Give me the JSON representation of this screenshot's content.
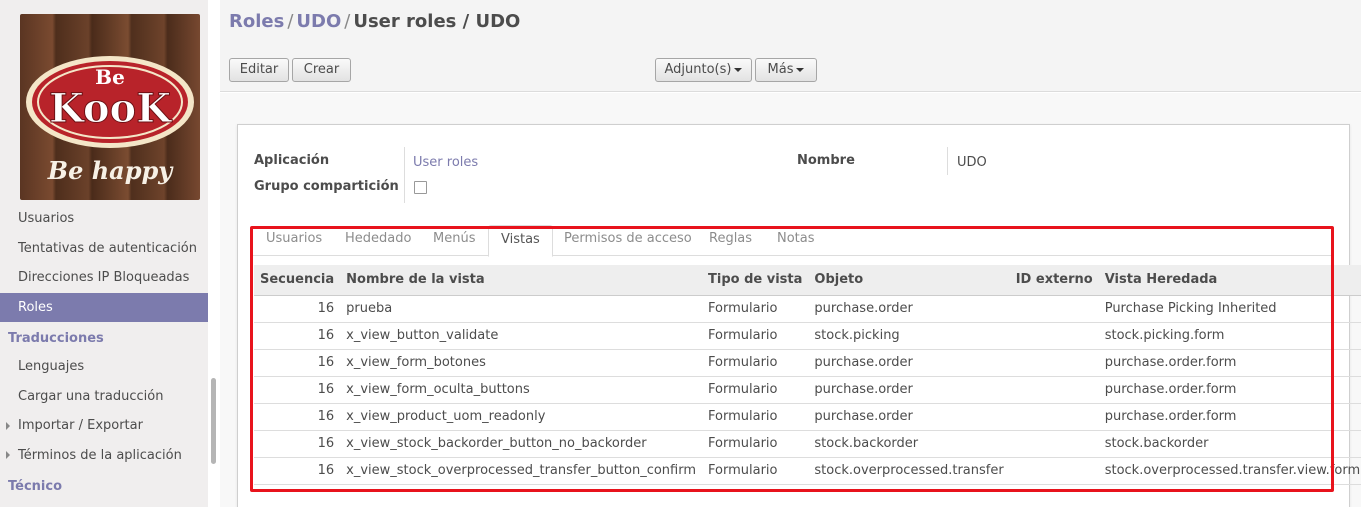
{
  "breadcrumb": {
    "item1": "Roles",
    "item2": "UDO",
    "item3": "User roles / UDO",
    "sep": "/"
  },
  "toolbar": {
    "edit": "Editar",
    "create": "Crear",
    "attachments": "Adjunto(s)",
    "more": "Más"
  },
  "logo": {
    "top": "Be",
    "brand": "KooK",
    "tagline": "Be happy"
  },
  "sidebar": {
    "items_top": [
      "Usuarios",
      "Tentativas de autenticación",
      "Direcciones IP Bloqueadas",
      "Roles"
    ],
    "section_translations": "Traducciones",
    "items_translations": [
      "Lenguajes",
      "Cargar una traducción",
      "Importar / Exportar",
      "Términos de la aplicación"
    ],
    "section_technical": "Técnico"
  },
  "form": {
    "app_label": "Aplicación",
    "app_value": "User roles",
    "group_label": "Grupo compartición",
    "name_label": "Nombre",
    "name_value": "UDO"
  },
  "tabs": [
    "Usuarios",
    "Hededado",
    "Menús",
    "Vistas",
    "Permisos de acceso",
    "Reglas",
    "Notas"
  ],
  "table": {
    "headers": [
      "Secuencia",
      "Nombre de la vista",
      "Tipo de vista",
      "Objeto",
      "ID externo",
      "Vista Heredada"
    ],
    "rows": [
      [
        "16",
        "prueba",
        "Formulario",
        "purchase.order",
        "",
        "Purchase Picking Inherited"
      ],
      [
        "16",
        "x_view_button_validate",
        "Formulario",
        "stock.picking",
        "",
        "stock.picking.form"
      ],
      [
        "16",
        "x_view_form_botones",
        "Formulario",
        "purchase.order",
        "",
        "purchase.order.form"
      ],
      [
        "16",
        "x_view_form_oculta_buttons",
        "Formulario",
        "purchase.order",
        "",
        "purchase.order.form"
      ],
      [
        "16",
        "x_view_product_uom_readonly",
        "Formulario",
        "purchase.order",
        "",
        "purchase.order.form"
      ],
      [
        "16",
        "x_view_stock_backorder_button_no_backorder",
        "Formulario",
        "stock.backorder",
        "",
        "stock.backorder"
      ],
      [
        "16",
        "x_view_stock_overprocessed_transfer_button_confirm",
        "Formulario",
        "stock.overprocessed.transfer",
        "",
        "stock.overprocessed.transfer.view.form"
      ]
    ]
  },
  "colors": {
    "accent": "#7c7bad",
    "highlight_box": "#e8131c"
  }
}
